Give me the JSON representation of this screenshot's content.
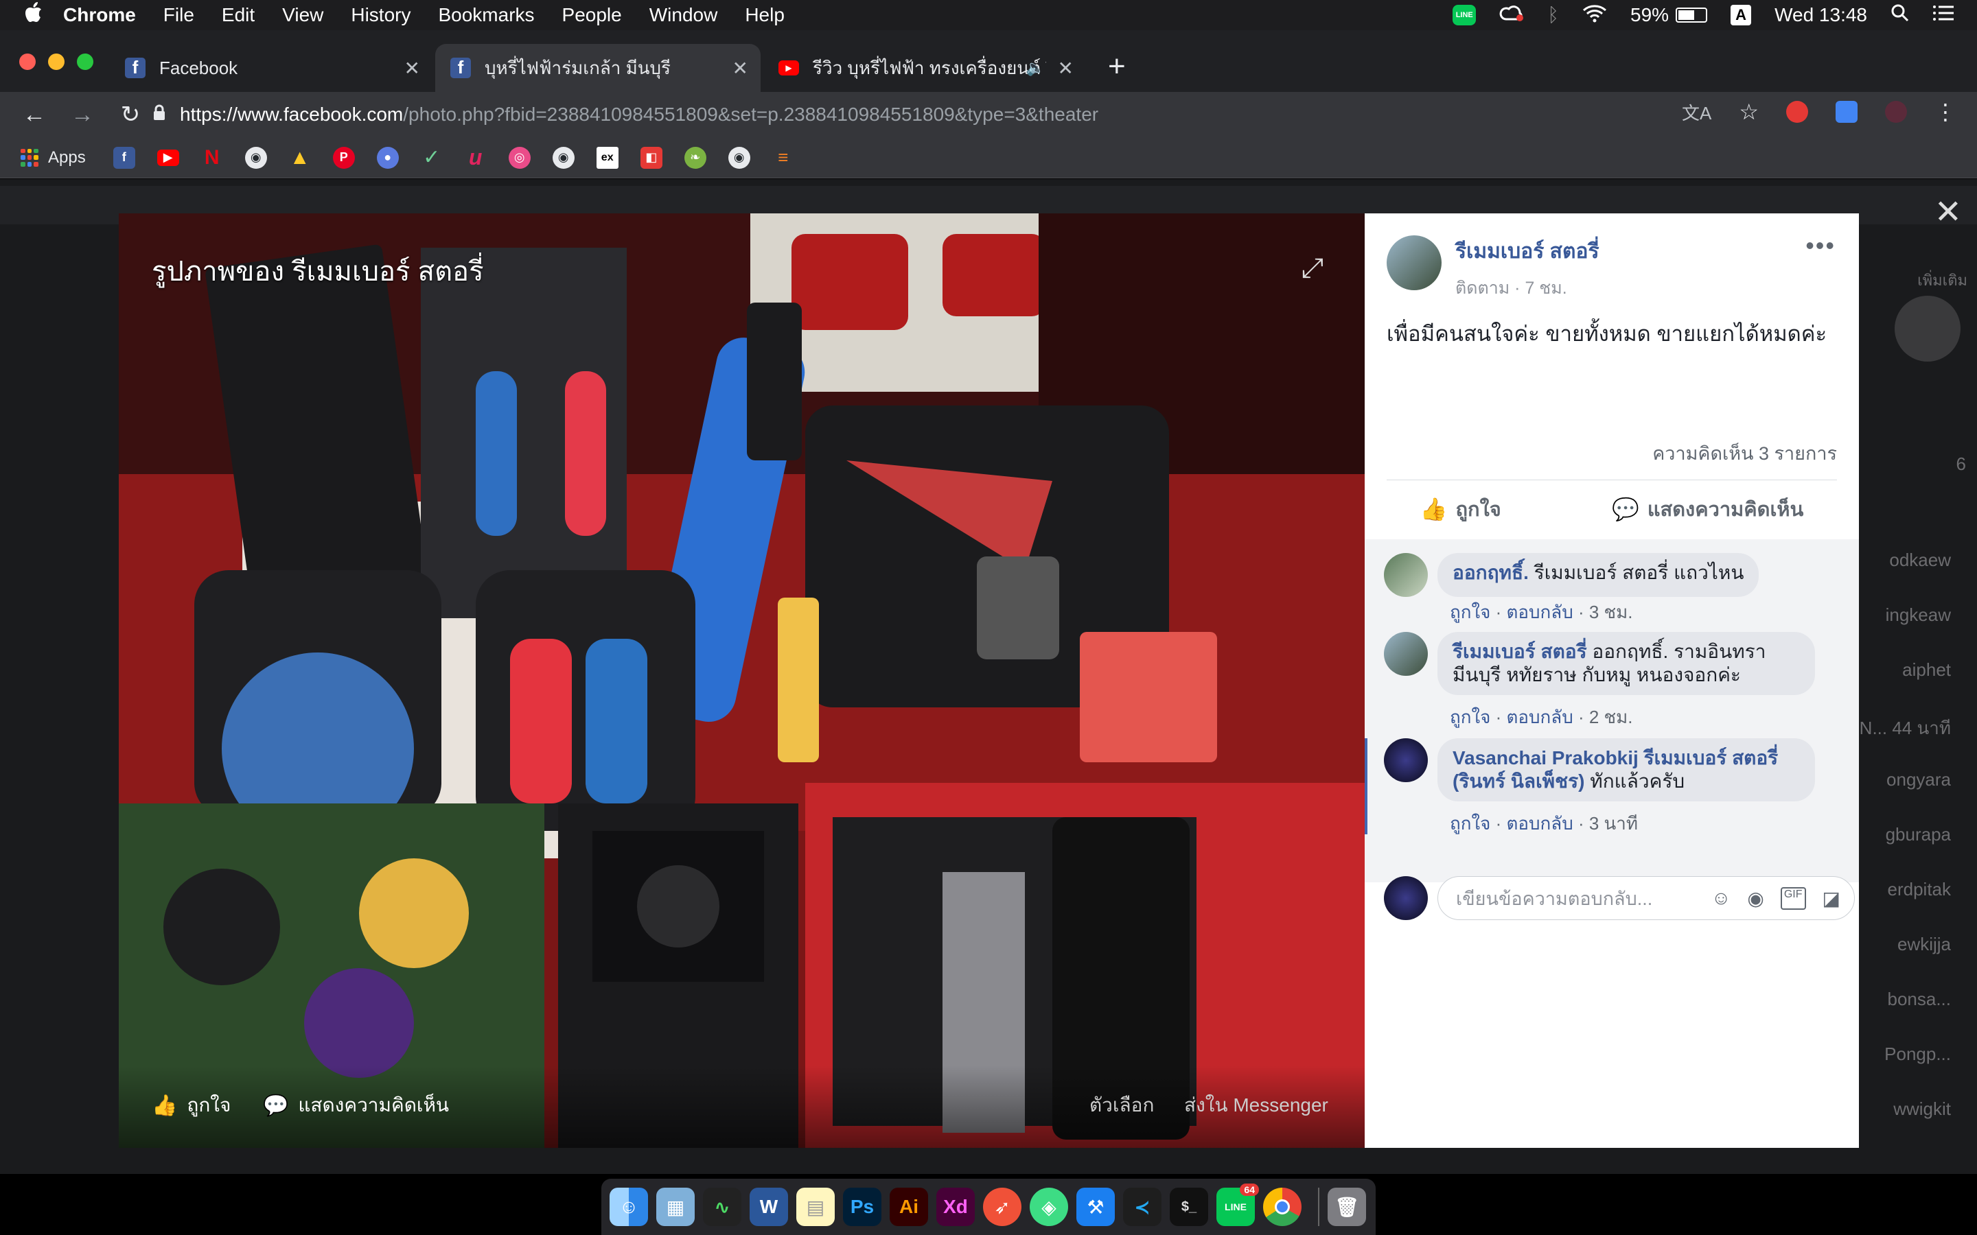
{
  "menubar": {
    "apple": "",
    "items": [
      "Chrome",
      "File",
      "Edit",
      "View",
      "History",
      "Bookmarks",
      "People",
      "Window",
      "Help"
    ],
    "battery": "59%",
    "input_indicator": "A",
    "clock": "Wed 13:48",
    "line_label": "LINE"
  },
  "tabs": [
    {
      "title": "Facebook"
    },
    {
      "title": "บุหรี่ไฟฟ้าร่มเกล้า มีนบุรี"
    },
    {
      "title": "รีวิว บุหรี่ไฟฟ้า ทรงเครื่องยนต์ V"
    }
  ],
  "address": {
    "host": "https://www.facebook.com",
    "path": "/photo.php?fbid=2388410984551809&set=p.2388410984551809&type=3&theater"
  },
  "bookmarks": {
    "apps_label": "Apps"
  },
  "page_background": {
    "right_names": [
      "odkaew",
      "ingkeaw",
      "aiphet",
      "N... 44 นาที",
      "ongyara",
      "gburapa",
      "erdpitak",
      "ewkijja",
      "bonsa...",
      "Pongp...",
      "wwigkit"
    ],
    "top_right_label": "เพิ่มเติม",
    "count": "6"
  },
  "photo": {
    "title": "รูปภาพของ รีเมมเบอร์ สตอรี่",
    "like": "ถูกใจ",
    "comment": "แสดงความคิดเห็น",
    "options": "ตัวเลือก",
    "send": "ส่งใน Messenger"
  },
  "post": {
    "author": "รีเมมเบอร์ สตอรี่",
    "sub": "ติดตาม · 7 ชม.",
    "text": "เพื่อมีคนสนใจค่ะ ขายทั้งหมด ขายแยกได้หมดค่ะ",
    "comment_count": "ความคิดเห็น 3 รายการ",
    "like_label": "ถูกใจ",
    "comment_label": "แสดงความคิดเห็น"
  },
  "comments": [
    {
      "name": "ออกฤทธิ์.",
      "text": " รีเมมเบอร์ สตอรี่ แถวไหน",
      "tag": "",
      "line2": "",
      "meta_like": "ถูกใจ",
      "meta_reply": "ตอบกลับ",
      "time": "3 ชม."
    },
    {
      "name": "รีเมมเบอร์ สตอรี่",
      "text": " ออกฤทธิ์. รามอินทรา",
      "tag": "",
      "line2": "มีนบุรี หทัยราษ กับหมู หนองจอกค่ะ",
      "meta_like": "ถูกใจ",
      "meta_reply": "ตอบกลับ",
      "time": "2 ชม."
    },
    {
      "name": "Vasanchai Prakobkij",
      "text": " รีเมมเบอร์ สตอรี่",
      "tag": "(รินทร์ นิลเพ็ชร)",
      "line2": " ทักแล้วครับ",
      "meta_like": "ถูกใจ",
      "meta_reply": "ตอบกลับ",
      "time": "3 นาที"
    }
  ],
  "reply_placeholder": "เขียนข้อความตอบกลับ...",
  "dock": {
    "badge": "64"
  },
  "colors": {
    "facebook_blue": "#385898",
    "chrome_dark": "#35363a",
    "tabstrip": "#202124"
  }
}
